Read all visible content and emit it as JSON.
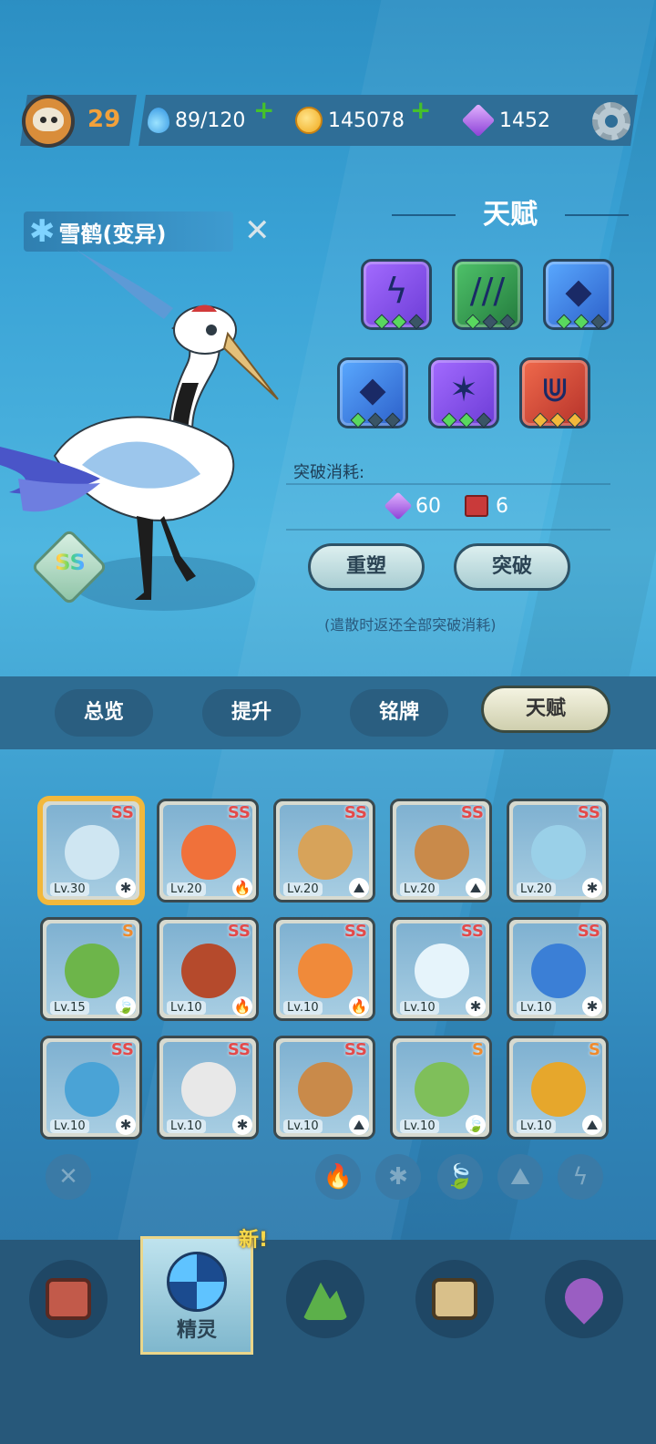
{
  "topbar": {
    "player_level": "29",
    "stamina": "89/120",
    "coins": "145078",
    "gems": "1452",
    "plus_icon": "+"
  },
  "pet": {
    "name": "雪鹤(变异)",
    "element_icon": "✱",
    "close_icon": "✕",
    "rarity": "SS"
  },
  "talent": {
    "title": "天赋",
    "slots": [
      {
        "icon": "lightning-claw-icon",
        "glyph": "ϟ",
        "color": "purple",
        "level": 2
      },
      {
        "icon": "slash-icon",
        "glyph": "///",
        "color": "green",
        "level": 1
      },
      {
        "icon": "shard-icon",
        "glyph": "◆",
        "color": "blue",
        "level": 2
      },
      {
        "icon": "shard-icon",
        "glyph": "◆",
        "color": "blue",
        "level": 1
      },
      {
        "icon": "cross-slash-icon",
        "glyph": "✶",
        "color": "purple",
        "level": 2
      },
      {
        "icon": "fang-icon",
        "glyph": "⋓",
        "color": "red",
        "level": 3
      }
    ],
    "cost_label": "突破消耗:",
    "cost_gems": "60",
    "cost_books": "6",
    "reshape_button": "重塑",
    "breakthrough_button": "突破",
    "note": "(遣散时返还全部突破消耗)"
  },
  "tabs": [
    "总览",
    "提升",
    "铭牌",
    "天赋"
  ],
  "pets": [
    {
      "rank": "SS",
      "lv": "Lv.30",
      "element": "✱",
      "color": "#cfe6f2"
    },
    {
      "rank": "SS",
      "lv": "Lv.20",
      "element": "🔥",
      "color": "#f0713a"
    },
    {
      "rank": "SS",
      "lv": "Lv.20",
      "element": "⛰",
      "color": "#d7a35a"
    },
    {
      "rank": "SS",
      "lv": "Lv.20",
      "element": "⛰",
      "color": "#c98a4a"
    },
    {
      "rank": "SS",
      "lv": "Lv.20",
      "element": "✱",
      "color": "#9ad0e8"
    },
    {
      "rank": "S",
      "lv": "Lv.15",
      "element": "🍃",
      "color": "#6db54a"
    },
    {
      "rank": "SS",
      "lv": "Lv.10",
      "element": "🔥",
      "color": "#b54a2c"
    },
    {
      "rank": "SS",
      "lv": "Lv.10",
      "element": "🔥",
      "color": "#f08a3a"
    },
    {
      "rank": "SS",
      "lv": "Lv.10",
      "element": "✱",
      "color": "#e6f4fb"
    },
    {
      "rank": "SS",
      "lv": "Lv.10",
      "element": "✱",
      "color": "#3b7fd6"
    },
    {
      "rank": "SS",
      "lv": "Lv.10",
      "element": "✱",
      "color": "#4aa3d6"
    },
    {
      "rank": "SS",
      "lv": "Lv.10",
      "element": "✱",
      "color": "#e8e8e8"
    },
    {
      "rank": "SS",
      "lv": "Lv.10",
      "element": "⛰",
      "color": "#c98a4a"
    },
    {
      "rank": "S",
      "lv": "Lv.10",
      "element": "🍃",
      "color": "#7fbf5a"
    },
    {
      "rank": "S",
      "lv": "Lv.10",
      "element": "⛰",
      "color": "#e6a72c"
    }
  ],
  "filters": [
    "✕",
    "🔥",
    "✱",
    "🍃",
    "⛰",
    "ϟ"
  ],
  "bottom_nav": {
    "active_label": "精灵",
    "new_badge": "新!"
  }
}
